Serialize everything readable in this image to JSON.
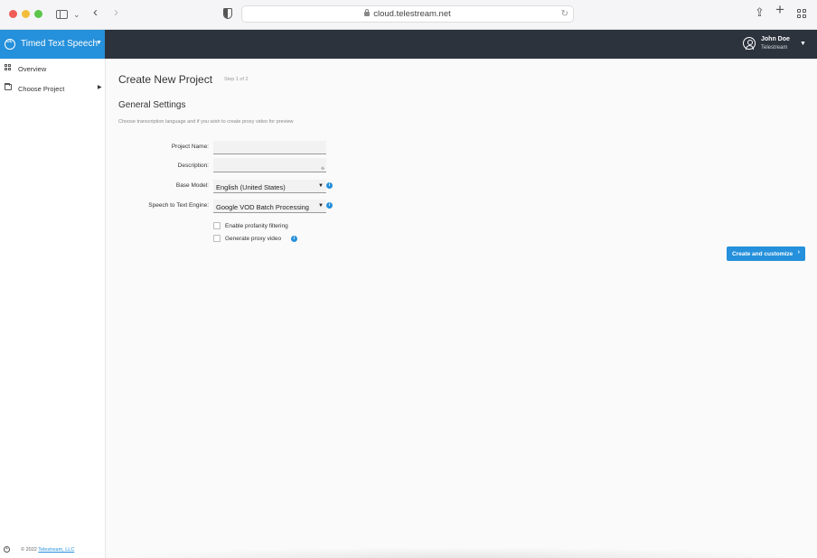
{
  "browser": {
    "url": "cloud.telestream.net",
    "nav_back_glyph": "‹",
    "nav_forward_glyph": "›",
    "icons": [
      "sidebar-toggle-icon",
      "chevron-down-icon",
      "shield-icon",
      "lock-icon",
      "reload-icon",
      "share-icon",
      "plus-icon",
      "tab-overview-icon"
    ]
  },
  "header": {
    "product_name": "Timed Text Speech",
    "user_name": "John Doe",
    "user_org": "Telestream"
  },
  "sidebar": {
    "items": [
      {
        "label": "Overview",
        "icon": "overview-icon"
      },
      {
        "label": "Choose Project",
        "icon": "folder-icon"
      }
    ],
    "footer_text": "© 2022",
    "footer_link": "Telestream, LLC"
  },
  "main": {
    "title": "Create New Project",
    "step": "Step 1 of 2",
    "section_title": "General Settings",
    "section_help": "Choose transcription language and if you wish to create proxy video for preview",
    "form": {
      "project_name_label": "Project Name:",
      "project_name_value": "",
      "description_label": "Description:",
      "description_value": "",
      "base_model_label": "Base Model:",
      "base_model_value": "English (United States)",
      "engine_label": "Speech to Text Engine:",
      "engine_value": "Google VOD Batch Processing",
      "profanity_label": "Enable profanity filtering",
      "profanity_checked": false,
      "proxy_label": "Generate proxy video",
      "proxy_checked": false
    },
    "primary_button": "Create and customize"
  },
  "colors": {
    "accent": "#2590db",
    "header_bg": "#2d333d",
    "page_bg": "#fafafa"
  }
}
